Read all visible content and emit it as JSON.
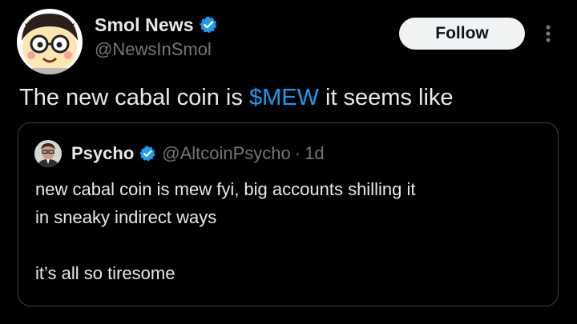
{
  "author": {
    "display_name": "Smol News",
    "handle": "@NewsInSmol",
    "avatar_icon": "cartoon-avatar-icon",
    "verified_icon": "verified-badge-icon"
  },
  "follow_button": {
    "label": "Follow"
  },
  "more_menu": {
    "icon": "more-vertical-icon"
  },
  "tweet": {
    "text_before": "The new cabal coin is ",
    "cashtag": "$MEW",
    "text_after": " it seems like"
  },
  "quoted_tweet": {
    "display_name": "Psycho",
    "handle": "@AltcoinPsycho",
    "separator": "·",
    "time": "1d",
    "avatar_icon": "profile-photo-icon",
    "verified_icon": "verified-badge-icon",
    "lines": [
      "new cabal coin is mew fyi, big accounts shilling it",
      "in sneaky indirect ways",
      "it’s all so tiresome"
    ]
  },
  "colors": {
    "background": "#000000",
    "text_primary": "#e7e9ea",
    "text_secondary": "#71767b",
    "accent": "#1d9bf0",
    "follow_bg": "#eff3f4",
    "border": "#3a3e43"
  }
}
